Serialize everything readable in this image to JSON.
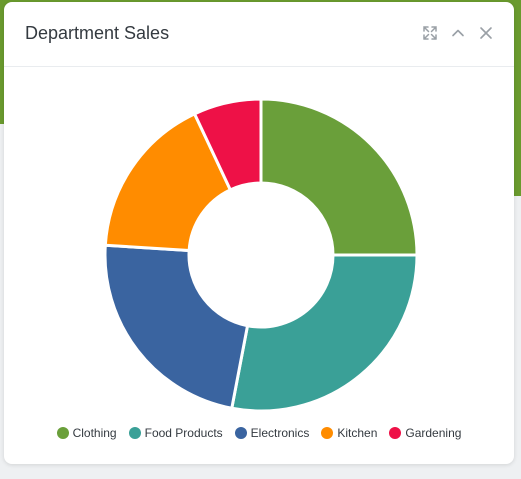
{
  "card": {
    "title": "Department Sales"
  },
  "header_icons": [
    "expand-icon",
    "chevron-up-icon",
    "close-icon"
  ],
  "chart_data": {
    "type": "pie",
    "donut": true,
    "categories": [
      "Clothing",
      "Food Products",
      "Electronics",
      "Kitchen",
      "Gardening"
    ],
    "values": [
      25,
      28,
      23,
      17,
      7
    ],
    "colors": [
      "#6a9f3a",
      "#3aa097",
      "#3a64a0",
      "#ff8c00",
      "#ee1147"
    ],
    "legend": "bottom"
  }
}
